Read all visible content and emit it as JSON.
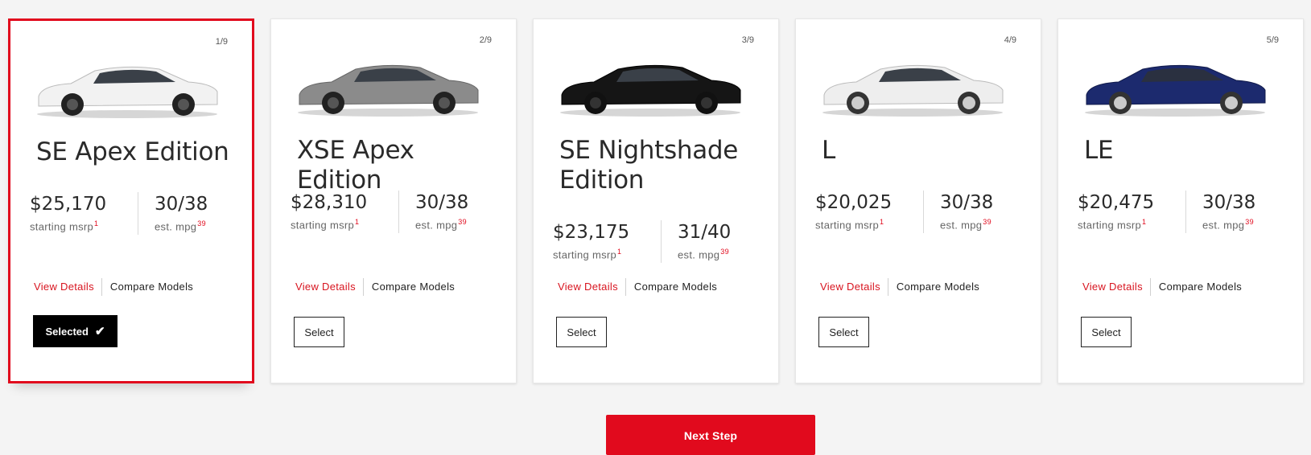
{
  "colors": {
    "accent": "#e10a1d",
    "page_bg": "#f4f4f4",
    "card_bg": "#ffffff"
  },
  "cards": [
    {
      "counter": "1/9",
      "name": "SE Apex Edition",
      "price": "$25,170",
      "price_label": "starting msrp",
      "price_sup": "1",
      "mpg": "30/38",
      "mpg_label": "est. mpg",
      "mpg_sup": "39",
      "view_details": "View Details",
      "compare": "Compare Models",
      "button_label": "Selected",
      "selected": true,
      "car_color": "#f2f2f2"
    },
    {
      "counter": "2/9",
      "name": "XSE Apex Edition",
      "price": "$28,310",
      "price_label": "starting msrp",
      "price_sup": "1",
      "mpg": "30/38",
      "mpg_label": "est. mpg",
      "mpg_sup": "39",
      "view_details": "View Details",
      "compare": "Compare Models",
      "button_label": "Select",
      "selected": false,
      "car_color": "#8b8b8b"
    },
    {
      "counter": "3/9",
      "name": "SE Nightshade Edition",
      "price": "$23,175",
      "price_label": "starting msrp",
      "price_sup": "1",
      "mpg": "31/40",
      "mpg_label": "est. mpg",
      "mpg_sup": "39",
      "view_details": "View Details",
      "compare": "Compare Models",
      "button_label": "Select",
      "selected": false,
      "car_color": "#151515"
    },
    {
      "counter": "4/9",
      "name": "L",
      "price": "$20,025",
      "price_label": "starting msrp",
      "price_sup": "1",
      "mpg": "30/38",
      "mpg_label": "est. mpg",
      "mpg_sup": "39",
      "view_details": "View Details",
      "compare": "Compare Models",
      "button_label": "Select",
      "selected": false,
      "car_color": "#eeeeee"
    },
    {
      "counter": "5/9",
      "name": "LE",
      "price": "$20,475",
      "price_label": "starting msrp",
      "price_sup": "1",
      "mpg": "30/38",
      "mpg_label": "est. mpg",
      "mpg_sup": "39",
      "view_details": "View Details",
      "compare": "Compare Models",
      "button_label": "Select",
      "selected": false,
      "car_color": "#1c2a6e"
    }
  ],
  "footer": {
    "next_step_label": "Next Step"
  }
}
